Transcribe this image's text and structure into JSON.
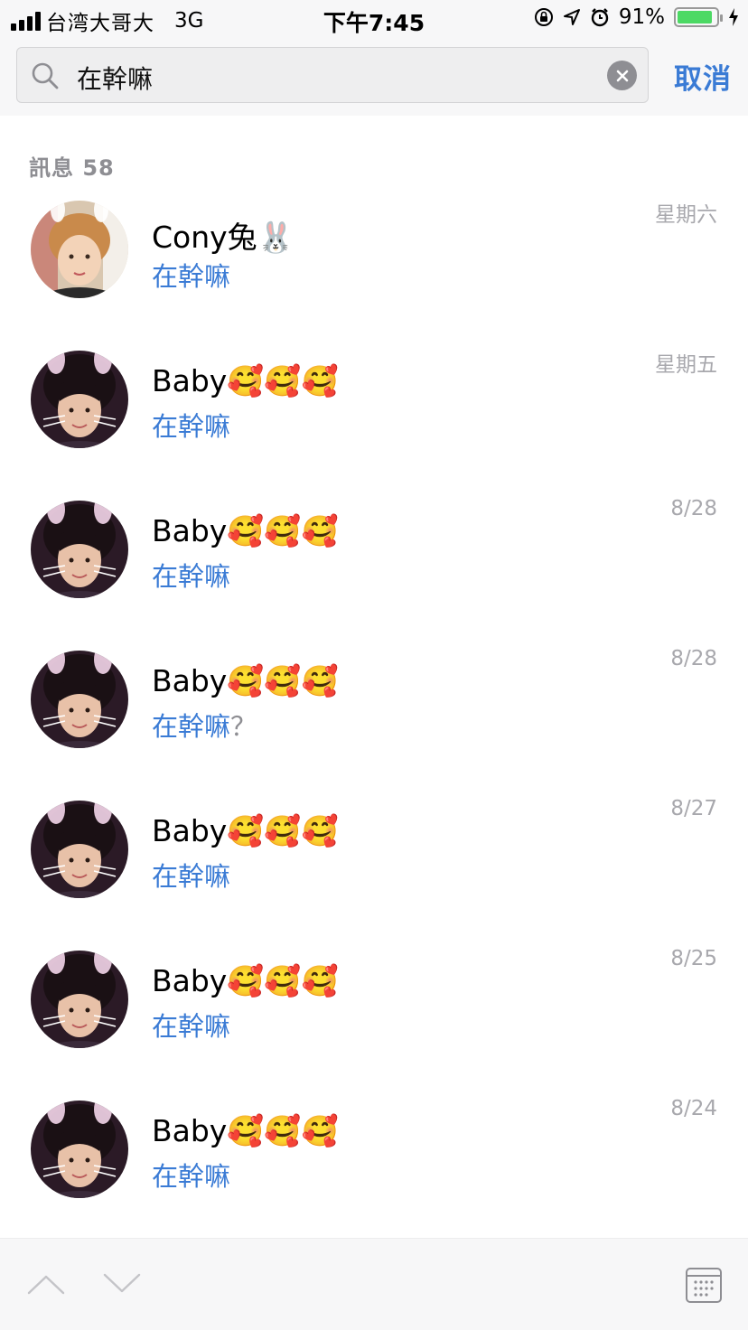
{
  "status_bar": {
    "carrier": "台湾大哥大",
    "network": "3G",
    "time": "下午7:45",
    "battery_percent": "91%",
    "battery_level": 0.91
  },
  "search": {
    "query": "在幹嘛",
    "cancel_label": "取消"
  },
  "section": {
    "title": "訊息 58"
  },
  "results": [
    {
      "name": "Cony兔🐰",
      "message": "在幹嘛",
      "rest": "",
      "date": "星期六",
      "avatar": "cony"
    },
    {
      "name": "Baby🥰🥰🥰",
      "message": "在幹嘛",
      "rest": "",
      "date": "星期五",
      "avatar": "baby"
    },
    {
      "name": "Baby🥰🥰🥰",
      "message": "在幹嘛",
      "rest": "",
      "date": "8/28",
      "avatar": "baby"
    },
    {
      "name": "Baby🥰🥰🥰",
      "message": "在幹嘛",
      "rest": "？",
      "date": "8/28",
      "avatar": "baby"
    },
    {
      "name": "Baby🥰🥰🥰",
      "message": "在幹嘛",
      "rest": "",
      "date": "8/27",
      "avatar": "baby"
    },
    {
      "name": "Baby🥰🥰🥰",
      "message": "在幹嘛",
      "rest": "",
      "date": "8/25",
      "avatar": "baby"
    },
    {
      "name": "Baby🥰🥰🥰",
      "message": "在幹嘛",
      "rest": "",
      "date": "8/24",
      "avatar": "baby"
    }
  ],
  "colors": {
    "accent": "#3a7bd5",
    "muted": "#8e8e93",
    "battery": "#4cd964"
  }
}
